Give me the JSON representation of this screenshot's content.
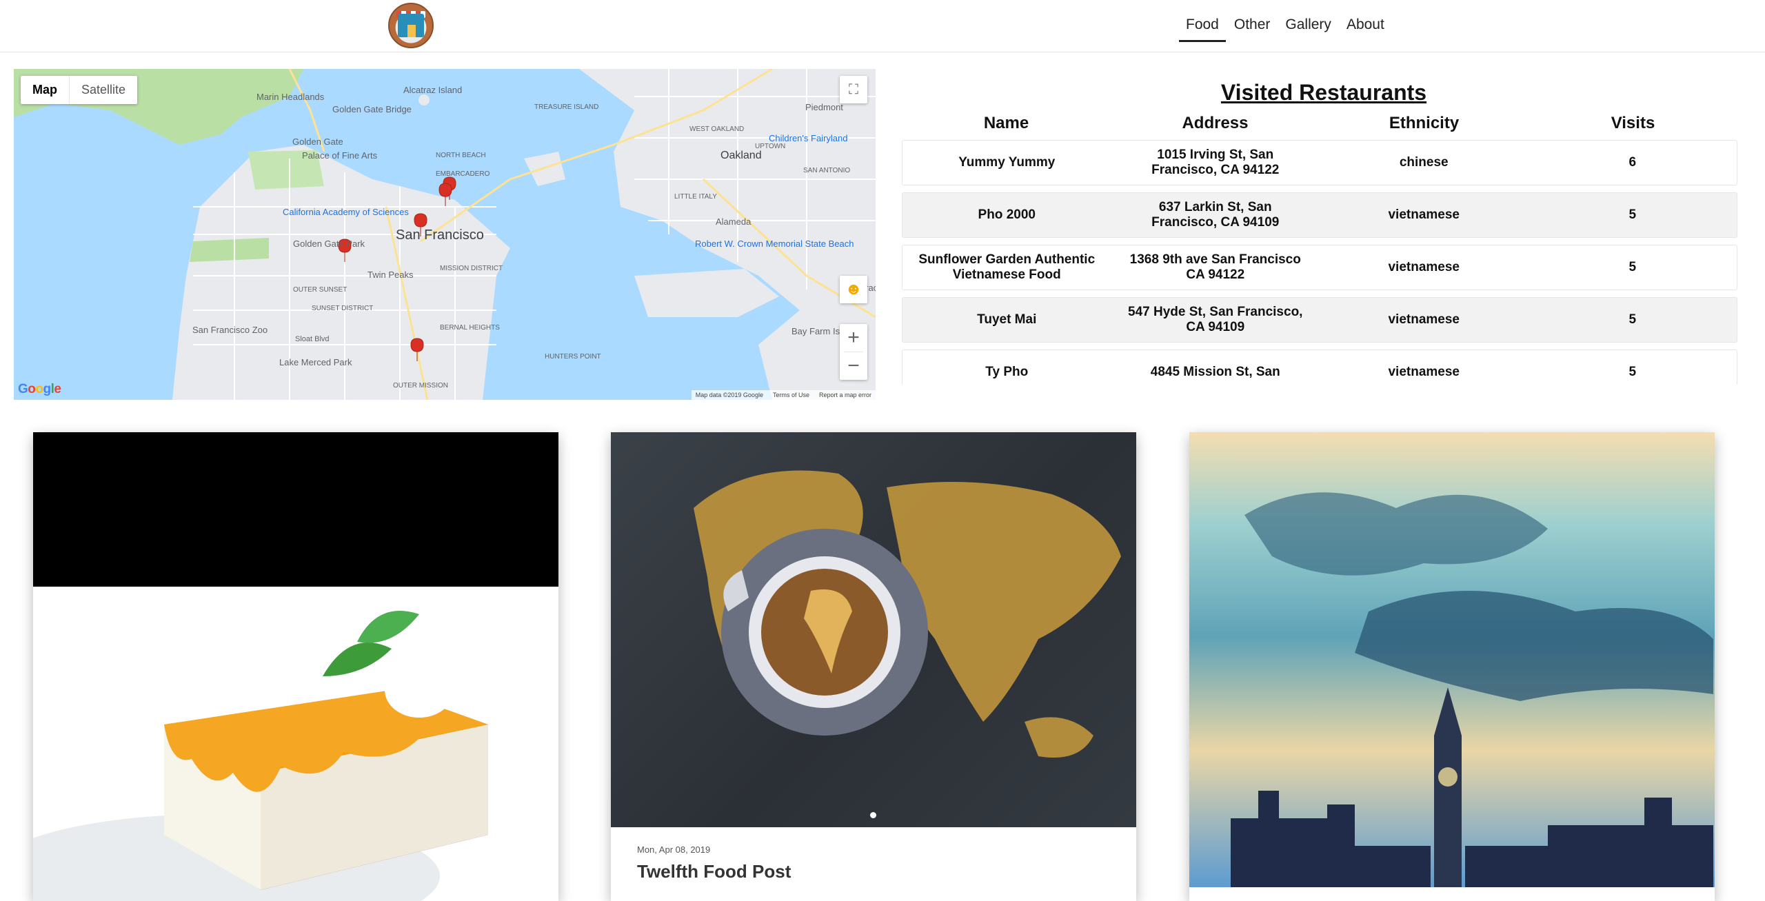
{
  "header": {
    "nav": [
      "Food",
      "Other",
      "Gallery",
      "About"
    ],
    "active_nav": "Food"
  },
  "map": {
    "type_buttons": [
      "Map",
      "Satellite"
    ],
    "labels": {
      "alcatraz": "Alcatraz Island",
      "marin": "Marin Headlands",
      "ggb": "Golden Gate Bridge",
      "golden_gate": "Golden Gate",
      "palace": "Palace of Fine Arts",
      "north_beach": "NORTH BEACH",
      "embarcadero": "EMBARCADERO",
      "treasure": "TREASURE ISLAND",
      "piedmont": "Piedmont",
      "childrens": "Children's Fairyland",
      "oakland": "Oakland",
      "uptown": "UPTOWN",
      "west_oakland": "WEST OAKLAND",
      "academy": "California Academy of Sciences",
      "sf": "San Francisco",
      "golden_gate_park": "Golden Gate Park",
      "twin_peaks": "Twin Peaks",
      "alameda": "Alameda",
      "robert_crown": "Robert W. Crown Memorial State Beach",
      "outer_sunset": "OUTER SUNSET",
      "sunset_district": "SUNSET DISTRICT",
      "mission": "MISSION DISTRICT",
      "bernal": "BERNAL HEIGHTS",
      "sf_zoo": "San Francisco Zoo",
      "sloat": "Sloat Blvd",
      "lake_merced": "Lake Merced Park",
      "hunters": "HUNTERS POINT",
      "outer_mission": "OUTER MISSION",
      "bay_farm": "Bay Farm Island",
      "oracle": "Oracl",
      "san_antonio": "SAN ANTONIO",
      "little_italy": "LITTLE ITALY"
    },
    "attribution": [
      "Map data ©2019 Google",
      "Terms of Use",
      "Report a map error"
    ],
    "google_logo": "Google",
    "zoom_in": "+",
    "zoom_out": "−",
    "icons": [
      "fullscreen-icon",
      "pegman-icon"
    ]
  },
  "restaurants": {
    "title": "Visited Restaurants",
    "columns": [
      "Name",
      "Address",
      "Ethnicity",
      "Visits"
    ],
    "rows": [
      {
        "name": "Yummy Yummy",
        "address": "1015 Irving St, San Francisco, CA 94122",
        "ethnicity": "chinese",
        "visits": "6"
      },
      {
        "name": "Pho 2000",
        "address": "637 Larkin St, San Francisco, CA 94109",
        "ethnicity": "vietnamese",
        "visits": "5"
      },
      {
        "name": "Sunflower Garden Authentic Vietnamese Food",
        "address": "1368 9th ave San Francisco CA 94122",
        "ethnicity": "vietnamese",
        "visits": "5"
      },
      {
        "name": "Tuyet Mai",
        "address": "547 Hyde St, San Francisco, CA 94109",
        "ethnicity": "vietnamese",
        "visits": "5"
      },
      {
        "name": "Ty Pho",
        "address": "4845 Mission St, San",
        "ethnicity": "vietnamese",
        "visits": "5"
      }
    ]
  },
  "cards": {
    "second": {
      "date": "Mon, Apr 08, 2019",
      "title": "Twelfth Food Post"
    }
  }
}
